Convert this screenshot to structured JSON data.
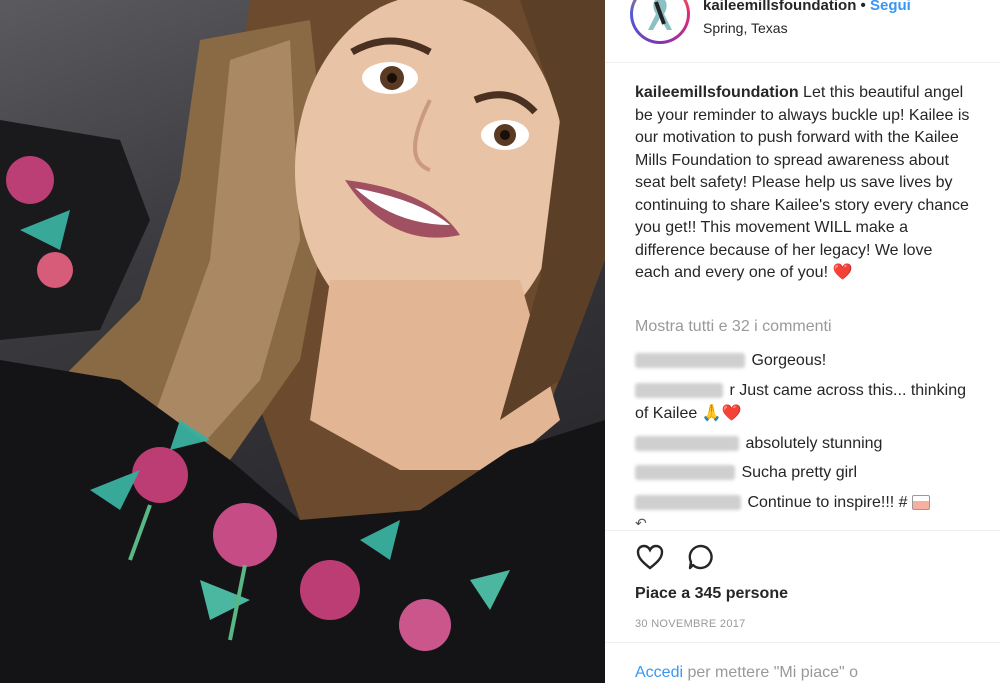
{
  "post": {
    "username": "kaileemillsfoundation",
    "follow_label": "Segui",
    "separator": "•",
    "location": "Spring, Texas"
  },
  "caption": {
    "username": "kaileemillsfoundation",
    "text": "Let this beautiful angel be your reminder to always buckle up! Kailee is our motivation to push forward with the Kailee Mills Foundation to spread awareness about seat belt safety! Please help us save lives by continuing to share Kailee's story every chance you get!! This movement WILL make a difference because of her legacy! We love each and every one of you!",
    "emoji": "❤️"
  },
  "comments": {
    "view_all": "Mostra tutti e 32 i commenti",
    "items": [
      {
        "text": "Gorgeous!"
      },
      {
        "text": "r Just came across this... thinking of Kailee",
        "emoji": "🙏❤️"
      },
      {
        "text": "absolutely stunning"
      },
      {
        "text": "Sucha pretty girl"
      },
      {
        "text": "Continue to inspire!!! #"
      }
    ]
  },
  "actions": {
    "like_icon": "heart-outline-icon",
    "comment_icon": "comment-bubble-icon"
  },
  "likes_text": "Piace a 345 persone",
  "date": "30 NOVEMBRE 2017",
  "login": {
    "link": "Accedi",
    "rest": "per mettere \"Mi piace\" o"
  },
  "colors": {
    "link": "#3897f0",
    "muted": "#999999",
    "text": "#262626"
  }
}
